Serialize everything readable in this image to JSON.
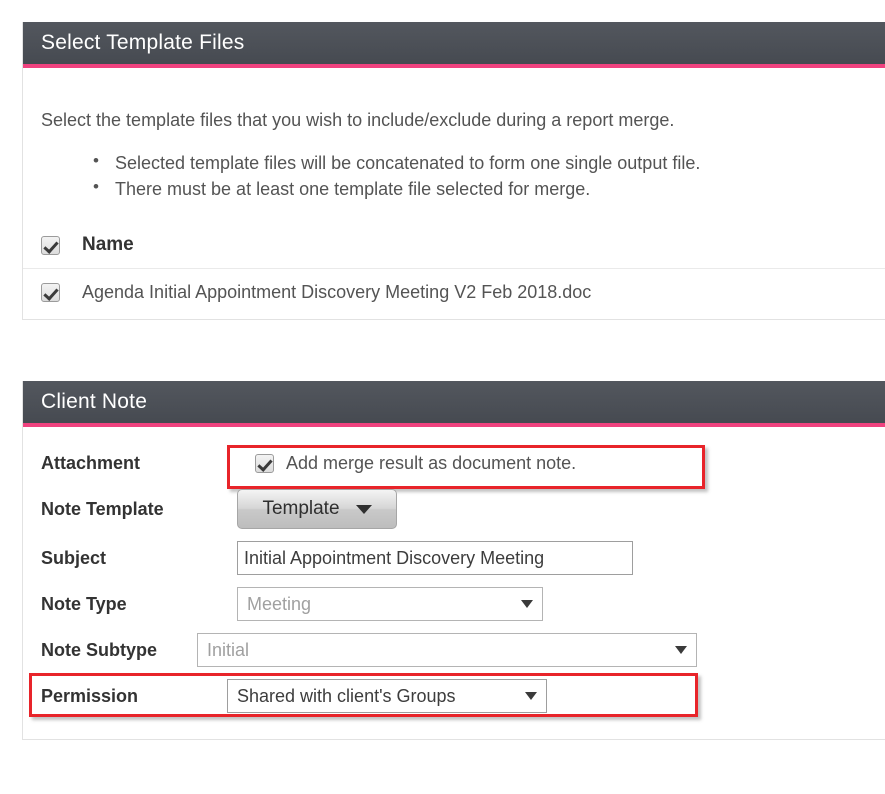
{
  "theme": {
    "header_bg": "#4a4e55",
    "accent_bar": "#f0427f",
    "highlight_border": "#e8242a",
    "body_text": "#545454",
    "label_text": "#333333"
  },
  "template_panel": {
    "title": "Select Template Files",
    "intro": "Select the template files that you wish to include/exclude during a report merge.",
    "bullets": [
      "Selected template files will be concatenated to form one single output file.",
      "There must be at least one template file selected for merge."
    ],
    "table": {
      "header_checkbox_checked": true,
      "columns": [
        "Name"
      ],
      "rows": [
        {
          "checked": true,
          "name": "Agenda Initial Appointment Discovery Meeting V2 Feb 2018.doc"
        }
      ]
    }
  },
  "client_note_panel": {
    "title": "Client Note",
    "fields": {
      "attachment": {
        "label": "Attachment",
        "checkbox_label": "Add merge result as document note.",
        "checked": true,
        "highlighted": true
      },
      "note_template": {
        "label": "Note Template",
        "button_text": "Template",
        "caret_icon": "chevron-down-icon"
      },
      "subject": {
        "label": "Subject",
        "value": "Initial Appointment Discovery Meeting ",
        "placeholder": ""
      },
      "note_type": {
        "label": "Note Type",
        "value": "Meeting",
        "disabled": true
      },
      "note_subtype": {
        "label": "Note Subtype",
        "value": "Initial",
        "disabled": true
      },
      "permission": {
        "label": "Permission",
        "value": "Shared with client's Groups",
        "highlighted": true
      }
    }
  }
}
